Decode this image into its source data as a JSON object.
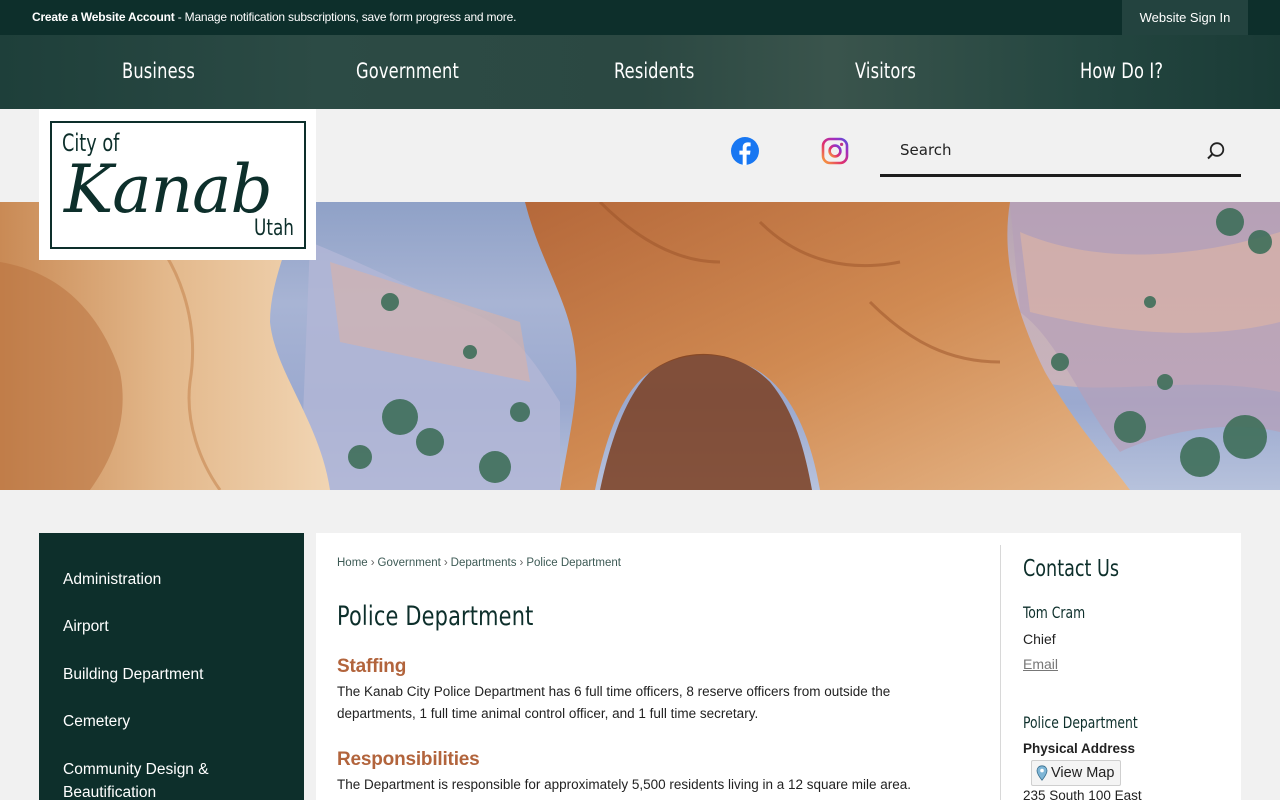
{
  "topbar": {
    "account_bold": "Create a Website Account",
    "account_text": " - Manage notification subscriptions, save form progress and more.",
    "signin_label": "Website Sign In"
  },
  "nav": {
    "items": [
      "Business",
      "Government",
      "Residents",
      "Visitors",
      "How Do I?"
    ]
  },
  "logo": {
    "line1": "City of",
    "line2": "Kanab",
    "line3": "Utah"
  },
  "social": {
    "icons": [
      "facebook-icon",
      "instagram-icon"
    ]
  },
  "search": {
    "placeholder": "Search"
  },
  "sidebar": {
    "items": [
      {
        "label": "Administration"
      },
      {
        "label": "Airport"
      },
      {
        "label": "Building Department"
      },
      {
        "label": "Cemetery"
      },
      {
        "label": "Community Design & Beautification"
      }
    ]
  },
  "breadcrumb": {
    "items": [
      "Home",
      "Government",
      "Departments",
      "Police Department"
    ],
    "separator": "›"
  },
  "main": {
    "title": "Police Department",
    "sections": [
      {
        "heading": "Staffing",
        "text": "The Kanab City Police Department has 6 full time officers, 8 reserve officers from outside the departments, 1 full time animal control officer, and 1 full time secretary."
      },
      {
        "heading": "Responsibilities",
        "text": "The Department is responsible for approximately 5,500 residents living in a 12 square mile area."
      }
    ]
  },
  "contact": {
    "heading": "Contact Us",
    "person_name": "Tom Cram",
    "person_role": "Chief",
    "email_label": "Email",
    "dept_name": "Police Department",
    "address_label": "Physical Address",
    "view_map_label": "View Map",
    "street": "235 South 100 East"
  },
  "colors": {
    "brand_dark": "#0d2f2b",
    "accent_heading": "#b2643c",
    "page_bg": "#f1f1f1"
  }
}
